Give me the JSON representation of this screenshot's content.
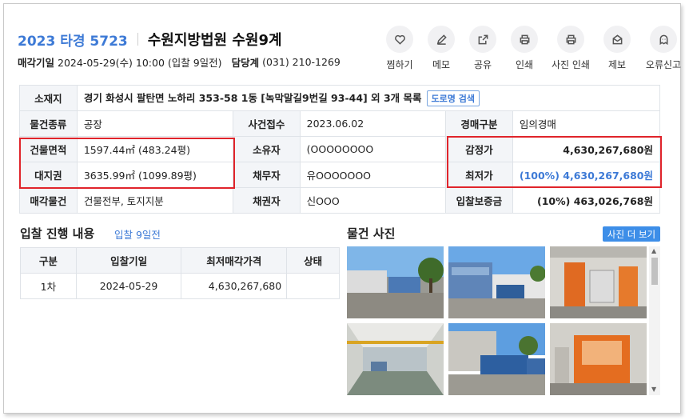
{
  "header": {
    "case_no": "2023 타경 5723",
    "court": "수원지방법원 수원9계",
    "sale_date_label": "매각기일",
    "sale_date_value": "2024-05-29(수) 10:00 (입찰 9일전)",
    "contact_label": "담당계",
    "contact_value": "(031) 210-1269"
  },
  "actions": [
    {
      "label": "찜하기",
      "icon": "heart-icon"
    },
    {
      "label": "메모",
      "icon": "pencil-icon"
    },
    {
      "label": "공유",
      "icon": "share-icon"
    },
    {
      "label": "인쇄",
      "icon": "printer-icon"
    },
    {
      "label": "사진 인쇄",
      "icon": "printer-icon"
    },
    {
      "label": "제보",
      "icon": "mail-icon"
    },
    {
      "label": "오류신고",
      "icon": "ghost-icon"
    }
  ],
  "info": {
    "location_label": "소재지",
    "location_value": "경기 화성시 팔탄면 노하리 353-58 1동 [녹막말길9번길 93-44] 외 3개 목록",
    "road_button": "도로명 검색",
    "type_label": "물건종류",
    "type_value": "공장",
    "case_received_label": "사건접수",
    "case_received_value": "2023.06.02",
    "auction_type_label": "경매구분",
    "auction_type_value": "임의경매",
    "building_area_label": "건물면적",
    "building_area_value": "1597.44㎡ (483.24평)",
    "owner_label": "소유자",
    "owner_value": "(OOOOOOOO",
    "appraisal_label": "감정가",
    "appraisal_value": "4,630,267,680원",
    "land_right_label": "대지권",
    "land_right_value": "3635.99㎡ (1099.89평)",
    "debtor_label": "채무자",
    "debtor_value": "유OOOOOOO",
    "min_price_label": "최저가",
    "min_price_value": "(100%) 4,630,267,680원",
    "sale_item_label": "매각물건",
    "sale_item_value": "건물전부, 토지지분",
    "creditor_label": "채권자",
    "creditor_value": "신OOO",
    "deposit_label": "입찰보증금",
    "deposit_value": "(10%) 463,026,768원"
  },
  "bid": {
    "title": "입찰 진행 내용",
    "subtitle": "입찰 9일전",
    "headers": [
      "구분",
      "입찰기일",
      "최저매각가격",
      "상태"
    ],
    "rows": [
      {
        "round": "1차",
        "date": "2024-05-29",
        "price": "4,630,267,680",
        "status": ""
      }
    ]
  },
  "photos": {
    "title": "물건 사진",
    "more_button": "사진 더 보기"
  },
  "colors": {
    "accent": "#3d7ad6",
    "highlight_border": "#e0242b",
    "button": "#3d8ee8"
  }
}
